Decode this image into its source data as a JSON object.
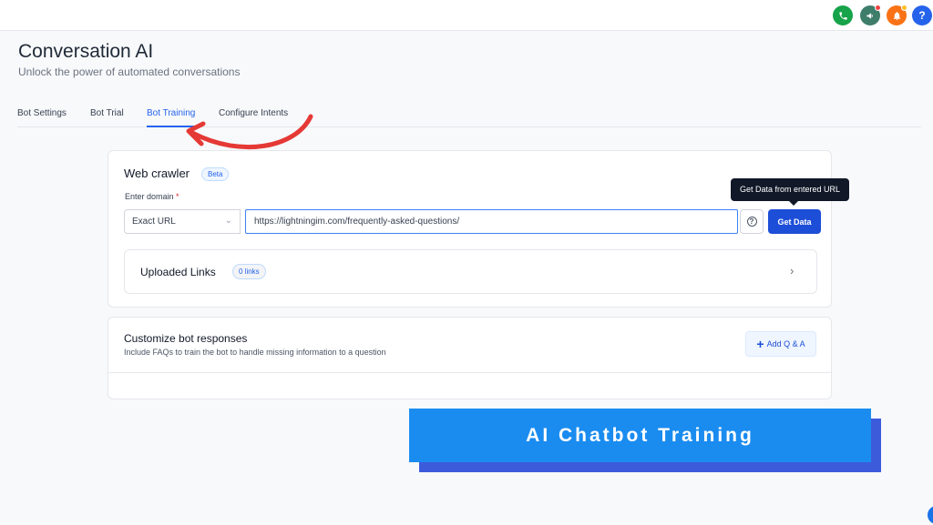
{
  "header": {
    "title": "Conversation AI",
    "subtitle": "Unlock the power of automated conversations"
  },
  "topbar": {
    "icons": [
      "phone-icon",
      "megaphone-icon",
      "bell-icon",
      "help-icon"
    ],
    "help_glyph": "?"
  },
  "tabs": [
    {
      "label": "Bot Settings",
      "active": false
    },
    {
      "label": "Bot Trial",
      "active": false
    },
    {
      "label": "Bot Training",
      "active": true
    },
    {
      "label": "Configure Intents",
      "active": false
    }
  ],
  "web_crawler": {
    "title": "Web crawler",
    "badge": "Beta",
    "domain_label": "Enter domain",
    "required_mark": "*",
    "match_type": "Exact URL",
    "url_value": "https://lightningim.com/frequently-asked-questions/",
    "help_glyph": "?",
    "get_data_label": "Get Data",
    "tooltip": "Get Data from entered URL"
  },
  "uploaded_links": {
    "title": "Uploaded Links",
    "badge": "0 links"
  },
  "customize": {
    "title": "Customize bot responses",
    "description": "Include FAQs to train the bot to handle missing information to a question",
    "add_label": "Add Q & A",
    "add_glyph": "+"
  },
  "banner": {
    "text": "AI Chatbot Training"
  },
  "colors": {
    "accent": "#2563eb",
    "primary_button": "#1d4ed8",
    "banner": "#1a8cf0",
    "arrow": "#e53935"
  }
}
